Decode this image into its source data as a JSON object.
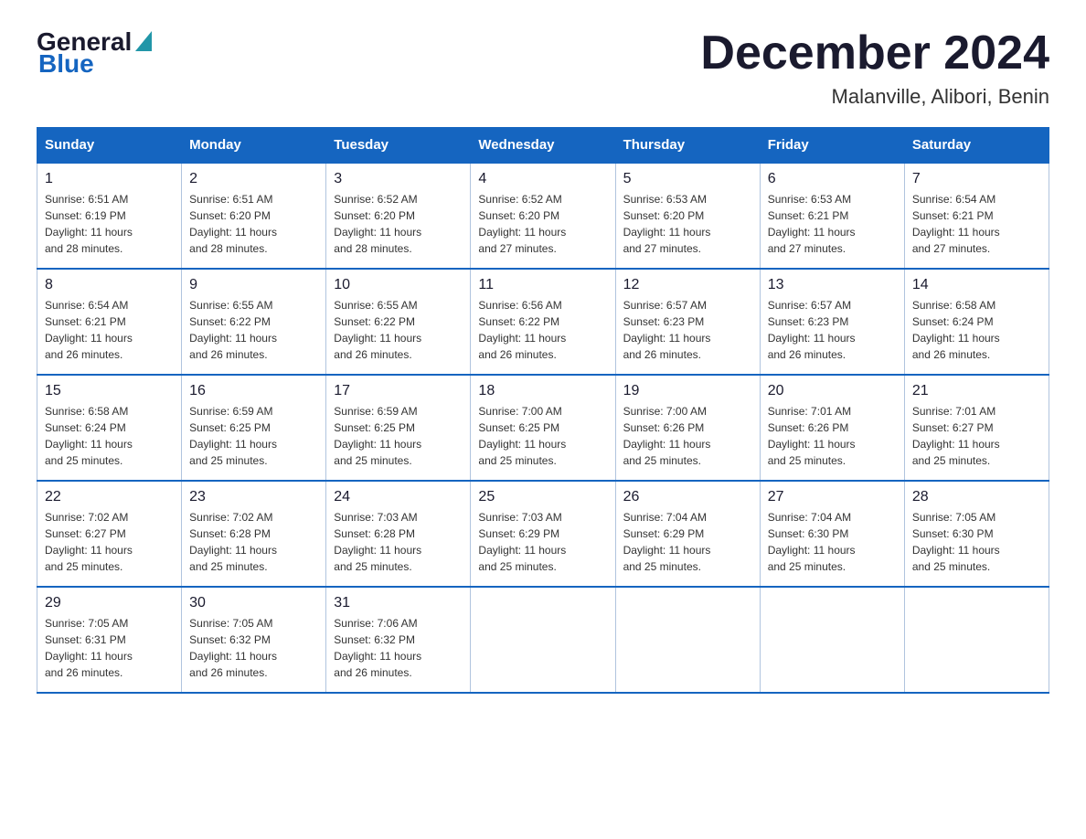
{
  "logo": {
    "general": "General",
    "blue": "Blue"
  },
  "title": "December 2024",
  "subtitle": "Malanville, Alibori, Benin",
  "days_of_week": [
    "Sunday",
    "Monday",
    "Tuesday",
    "Wednesday",
    "Thursday",
    "Friday",
    "Saturday"
  ],
  "weeks": [
    [
      {
        "day": "1",
        "sunrise": "6:51 AM",
        "sunset": "6:19 PM",
        "daylight": "11 hours and 28 minutes."
      },
      {
        "day": "2",
        "sunrise": "6:51 AM",
        "sunset": "6:20 PM",
        "daylight": "11 hours and 28 minutes."
      },
      {
        "day": "3",
        "sunrise": "6:52 AM",
        "sunset": "6:20 PM",
        "daylight": "11 hours and 28 minutes."
      },
      {
        "day": "4",
        "sunrise": "6:52 AM",
        "sunset": "6:20 PM",
        "daylight": "11 hours and 27 minutes."
      },
      {
        "day": "5",
        "sunrise": "6:53 AM",
        "sunset": "6:20 PM",
        "daylight": "11 hours and 27 minutes."
      },
      {
        "day": "6",
        "sunrise": "6:53 AM",
        "sunset": "6:21 PM",
        "daylight": "11 hours and 27 minutes."
      },
      {
        "day": "7",
        "sunrise": "6:54 AM",
        "sunset": "6:21 PM",
        "daylight": "11 hours and 27 minutes."
      }
    ],
    [
      {
        "day": "8",
        "sunrise": "6:54 AM",
        "sunset": "6:21 PM",
        "daylight": "11 hours and 26 minutes."
      },
      {
        "day": "9",
        "sunrise": "6:55 AM",
        "sunset": "6:22 PM",
        "daylight": "11 hours and 26 minutes."
      },
      {
        "day": "10",
        "sunrise": "6:55 AM",
        "sunset": "6:22 PM",
        "daylight": "11 hours and 26 minutes."
      },
      {
        "day": "11",
        "sunrise": "6:56 AM",
        "sunset": "6:22 PM",
        "daylight": "11 hours and 26 minutes."
      },
      {
        "day": "12",
        "sunrise": "6:57 AM",
        "sunset": "6:23 PM",
        "daylight": "11 hours and 26 minutes."
      },
      {
        "day": "13",
        "sunrise": "6:57 AM",
        "sunset": "6:23 PM",
        "daylight": "11 hours and 26 minutes."
      },
      {
        "day": "14",
        "sunrise": "6:58 AM",
        "sunset": "6:24 PM",
        "daylight": "11 hours and 26 minutes."
      }
    ],
    [
      {
        "day": "15",
        "sunrise": "6:58 AM",
        "sunset": "6:24 PM",
        "daylight": "11 hours and 25 minutes."
      },
      {
        "day": "16",
        "sunrise": "6:59 AM",
        "sunset": "6:25 PM",
        "daylight": "11 hours and 25 minutes."
      },
      {
        "day": "17",
        "sunrise": "6:59 AM",
        "sunset": "6:25 PM",
        "daylight": "11 hours and 25 minutes."
      },
      {
        "day": "18",
        "sunrise": "7:00 AM",
        "sunset": "6:25 PM",
        "daylight": "11 hours and 25 minutes."
      },
      {
        "day": "19",
        "sunrise": "7:00 AM",
        "sunset": "6:26 PM",
        "daylight": "11 hours and 25 minutes."
      },
      {
        "day": "20",
        "sunrise": "7:01 AM",
        "sunset": "6:26 PM",
        "daylight": "11 hours and 25 minutes."
      },
      {
        "day": "21",
        "sunrise": "7:01 AM",
        "sunset": "6:27 PM",
        "daylight": "11 hours and 25 minutes."
      }
    ],
    [
      {
        "day": "22",
        "sunrise": "7:02 AM",
        "sunset": "6:27 PM",
        "daylight": "11 hours and 25 minutes."
      },
      {
        "day": "23",
        "sunrise": "7:02 AM",
        "sunset": "6:28 PM",
        "daylight": "11 hours and 25 minutes."
      },
      {
        "day": "24",
        "sunrise": "7:03 AM",
        "sunset": "6:28 PM",
        "daylight": "11 hours and 25 minutes."
      },
      {
        "day": "25",
        "sunrise": "7:03 AM",
        "sunset": "6:29 PM",
        "daylight": "11 hours and 25 minutes."
      },
      {
        "day": "26",
        "sunrise": "7:04 AM",
        "sunset": "6:29 PM",
        "daylight": "11 hours and 25 minutes."
      },
      {
        "day": "27",
        "sunrise": "7:04 AM",
        "sunset": "6:30 PM",
        "daylight": "11 hours and 25 minutes."
      },
      {
        "day": "28",
        "sunrise": "7:05 AM",
        "sunset": "6:30 PM",
        "daylight": "11 hours and 25 minutes."
      }
    ],
    [
      {
        "day": "29",
        "sunrise": "7:05 AM",
        "sunset": "6:31 PM",
        "daylight": "11 hours and 26 minutes."
      },
      {
        "day": "30",
        "sunrise": "7:05 AM",
        "sunset": "6:32 PM",
        "daylight": "11 hours and 26 minutes."
      },
      {
        "day": "31",
        "sunrise": "7:06 AM",
        "sunset": "6:32 PM",
        "daylight": "11 hours and 26 minutes."
      },
      null,
      null,
      null,
      null
    ]
  ],
  "labels": {
    "sunrise": "Sunrise:",
    "sunset": "Sunset:",
    "daylight": "Daylight:"
  }
}
